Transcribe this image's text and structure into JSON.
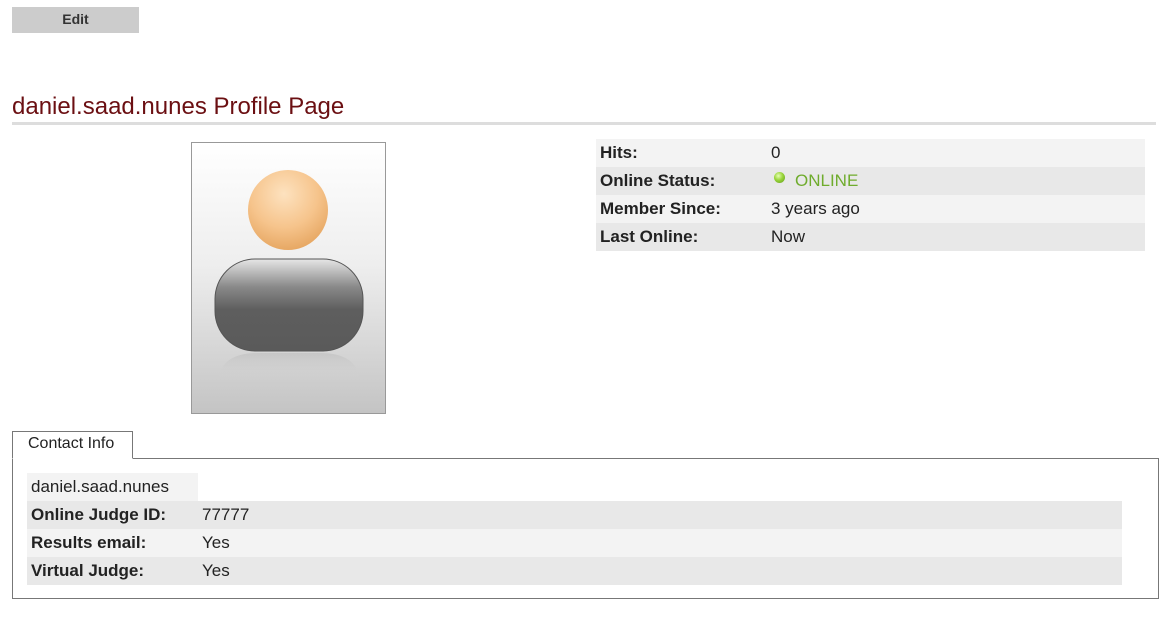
{
  "toolbar": {
    "edit_label": "Edit"
  },
  "profile": {
    "title": "daniel.saad.nunes Profile Page",
    "avatar": "default-user-avatar"
  },
  "info": [
    {
      "label": "Hits:",
      "value": "0"
    },
    {
      "label": "Online Status:",
      "value": "ONLINE"
    },
    {
      "label": "Member Since:",
      "value": "3 years ago"
    },
    {
      "label": "Last Online:",
      "value": "Now"
    }
  ],
  "colors": {
    "title": "#6b0f12",
    "online": "#6fac2d",
    "button": "#cccccc"
  },
  "contact": {
    "tab_label": "Contact Info",
    "username": "daniel.saad.nunes",
    "rows": [
      {
        "label": "Online Judge ID:",
        "value": "77777"
      },
      {
        "label": "Results email:",
        "value": "Yes"
      },
      {
        "label": "Virtual Judge:",
        "value": "Yes"
      }
    ]
  }
}
